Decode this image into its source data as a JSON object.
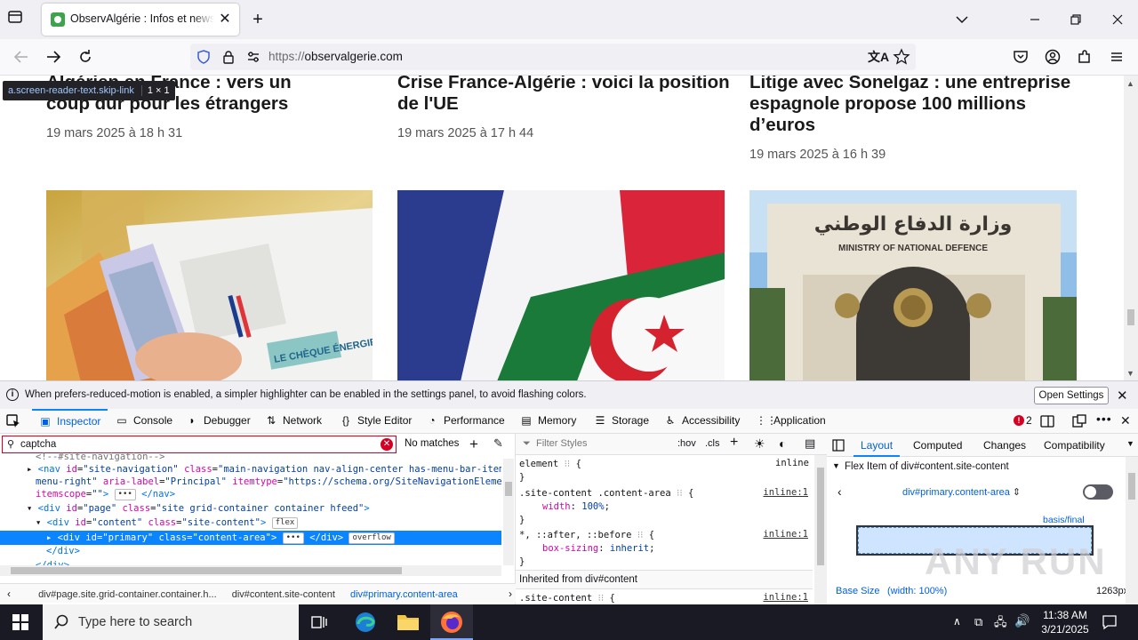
{
  "browser": {
    "tab_title": "ObservAlgérie : Infos et news politique",
    "url_protocol": "https://",
    "url_host": "observalgerie.com"
  },
  "page": {
    "tooltip_selector": "a.screen-reader-text.skip-link",
    "tooltip_dims": "1 × 1",
    "articles": [
      {
        "title_lines": [
          "Algérien en France : vers un",
          "coup dur pour les étrangers"
        ],
        "date": "19 mars 2025 à 18 h 31"
      },
      {
        "title_lines": [
          "Crise France-Algérie : voici la position",
          "de l'UE"
        ],
        "date": "19 mars 2025 à 17 h 44"
      },
      {
        "title_lines": [
          "Litige avec Sonelgaz : une entreprise",
          "espagnole propose 100 millions",
          "d’euros"
        ],
        "date": "19 mars 2025 à 16 h 39"
      }
    ],
    "image3_arabic": "وزارة الدفاع الوطني",
    "image3_english": "MINISTRY OF NATIONAL DEFENCE",
    "image1_text": "LE CHÈQUE ÉNERGIE"
  },
  "notification": {
    "text": "When prefers-reduced-motion is enabled, a simpler highlighter can be enabled in the settings panel, to avoid flashing colors.",
    "button": "Open Settings"
  },
  "devtools": {
    "tabs": [
      "Inspector",
      "Console",
      "Debugger",
      "Network",
      "Style Editor",
      "Performance",
      "Memory",
      "Storage",
      "Accessibility",
      "Application"
    ],
    "error_count": "2",
    "search_value": "captcha",
    "no_matches": "No matches",
    "filter_placeholder": "Filter Styles",
    "hov": ":hov",
    "cls": ".cls",
    "breadcrumbs": [
      "div#page.site.grid-container.container.h...",
      "div#content.site-content",
      "div#primary.content-area"
    ],
    "layout_tabs": [
      "Layout",
      "Computed",
      "Changes",
      "Compatibility"
    ],
    "flex_item_title": "Flex Item of div#content.site-content",
    "flex_selector": "div#primary.content-area",
    "basis_label": "basis/final",
    "base_size_label": "Base Size",
    "base_size_note": "(width: 100%)",
    "base_size_value": "1263px",
    "rules": {
      "element_selector": "element",
      "inline": "inline",
      "r1_selector": ".site-content .content-area",
      "r1_src": "inline:1",
      "r1_prop": "width",
      "r1_val": "100%",
      "r2_selector": "*, ::after, ::before",
      "r2_src": "inline:1",
      "r2_prop": "box-sizing",
      "r2_val": "inherit",
      "inherited": "Inherited from div#content",
      "r3_selector": ".site-content",
      "r3_src": "inline:1"
    }
  },
  "taskbar": {
    "search_placeholder": "Type here to search",
    "time": "11:38 AM",
    "date": "3/21/2025"
  },
  "watermark": "ANY RUN"
}
